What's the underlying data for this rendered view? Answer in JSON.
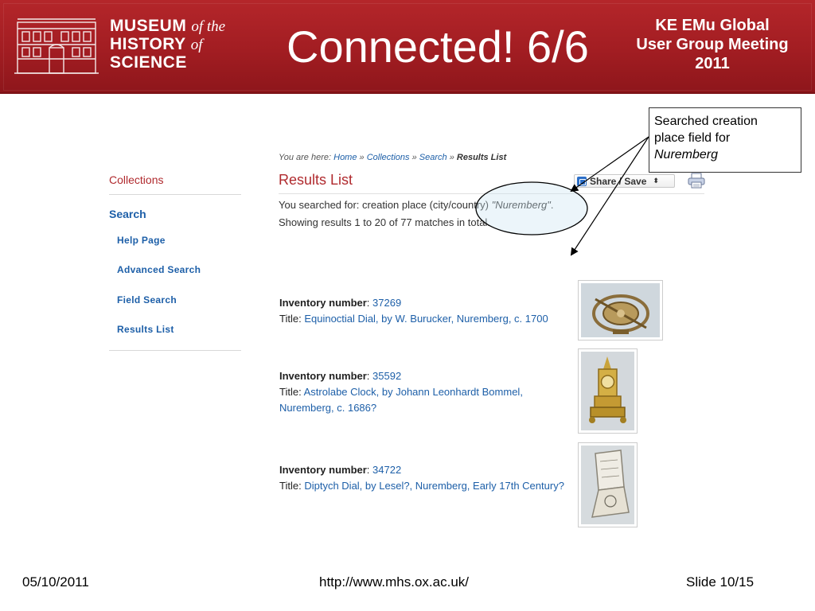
{
  "header": {
    "logo_lines": [
      "MUSEUM",
      "HISTORY",
      "SCIENCE"
    ],
    "logo_italics": [
      "of the",
      "of"
    ],
    "slide_title": "Connected! 6/6",
    "meeting_lines": [
      "KE EMu Global",
      "User Group Meeting",
      "2011"
    ]
  },
  "callout": {
    "line1": "Searched creation",
    "line2": "place field for",
    "line3": "Nuremberg"
  },
  "breadcrumb": {
    "prefix": "You are here:",
    "items": [
      "Home",
      "Collections",
      "Search",
      "Results List"
    ],
    "separator": "»"
  },
  "page": {
    "results_title": "Results List",
    "query_prefix": "You searched for: creation place (city/country)",
    "query_value": "\"Nuremberg\"",
    "query_suffix": ".",
    "count_text": "Showing results 1 to 20 of 77 matches in total.",
    "share_label": "Share / Save",
    "share_arrow": "⬍"
  },
  "sidebar": {
    "collections": "Collections",
    "search": "Search",
    "links": [
      "Help Page",
      "Advanced Search",
      "Field Search",
      "Results List"
    ]
  },
  "results": [
    {
      "inv_label": "Inventory number",
      "inv_number": "37269",
      "title_label": "Title:",
      "title": "Equinoctial Dial, by W. Burucker, Nuremberg, c. 1700"
    },
    {
      "inv_label": "Inventory number",
      "inv_number": "35592",
      "title_label": "Title:",
      "title": "Astrolabe Clock, by Johann Leonhardt Bommel, Nuremberg, c. 1686?"
    },
    {
      "inv_label": "Inventory number",
      "inv_number": "34722",
      "title_label": "Title:",
      "title": "Diptych Dial, by Lesel?, Nuremberg, Early 17th Century?"
    }
  ],
  "footer": {
    "date": "05/10/2011",
    "url": "http://www.mhs.ox.ac.uk/",
    "slide": "Slide 10/15"
  },
  "colors": {
    "banner": "#a21d22",
    "heading_red": "#b02a2e",
    "link_blue": "#1d5fa8"
  },
  "icons": [
    "museum-building-icon",
    "share-icon",
    "printer-icon"
  ]
}
